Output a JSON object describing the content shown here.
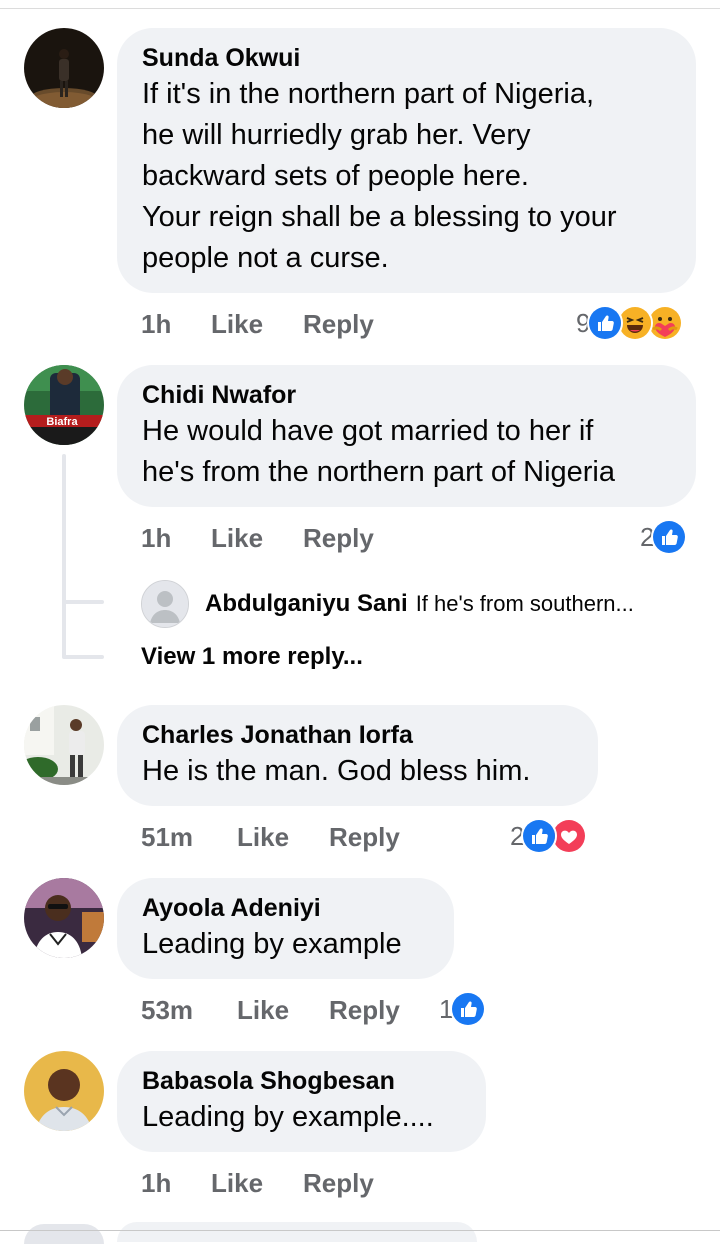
{
  "comments": [
    {
      "author": "Sunda Okwui",
      "text": "If it's in the northern part of Nigeria,\nhe will hurriedly grab her. Very\nbackward sets of people here.\nYour reign shall be a blessing to your\npeople not a curse.",
      "time": "1h",
      "like": "Like",
      "reply": "Reply",
      "reaction_count": "9",
      "reactions": [
        "like-icon",
        "haha-icon",
        "care-icon"
      ]
    },
    {
      "author": "Chidi Nwafor",
      "text": "He would have got married to her if\nhe's from the northern part of Nigeria",
      "time": "1h",
      "like": "Like",
      "reply": "Reply",
      "reaction_count": "2",
      "reactions": [
        "like-icon"
      ],
      "avatar_text": "Biafra",
      "reply_preview": {
        "author": "Abdulganiyu Sani",
        "snippet": "If he's from southern..."
      },
      "more_replies": "View 1 more reply..."
    },
    {
      "author": "Charles Jonathan Iorfa",
      "text": "He is the man. God bless him.",
      "time": "51m",
      "like": "Like",
      "reply": "Reply",
      "reaction_count": "2",
      "reactions": [
        "like-icon",
        "love-icon"
      ]
    },
    {
      "author": "Ayoola Adeniyi",
      "text": "Leading by example",
      "time": "53m",
      "like": "Like",
      "reply": "Reply",
      "reaction_count": "1",
      "reactions": [
        "like-icon"
      ]
    },
    {
      "author": "Babasola Shogbesan",
      "text": "Leading by example....",
      "time": "1h",
      "like": "Like",
      "reply": "Reply"
    }
  ],
  "colors": {
    "bubble": "#f0f2f5",
    "meta_text": "#65676b",
    "like_blue": "#1877f2",
    "love_red": "#f33e58",
    "haha_yellow": "#f7b125"
  }
}
